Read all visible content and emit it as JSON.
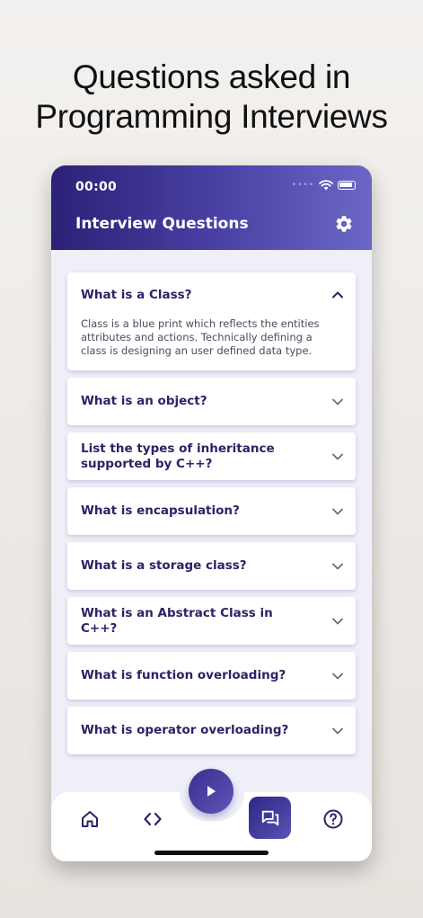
{
  "promo": {
    "line1": "Questions asked in",
    "line2": "Programming Interviews"
  },
  "status_bar": {
    "time": "00:00",
    "icons": [
      "signal-dots-icon",
      "wifi-icon",
      "battery-icon"
    ]
  },
  "app_bar": {
    "title": "Interview Questions",
    "settings_icon": "gear-icon"
  },
  "questions": [
    {
      "question": "What is a Class?",
      "expanded": true,
      "answer": "Class is a blue print which reflects the entities attributes and actions. Technically defining a class is designing an user defined data type."
    },
    {
      "question": "What is an object?",
      "expanded": false
    },
    {
      "question": "List the types of inheritance supported by C++?",
      "expanded": false
    },
    {
      "question": "What is encapsulation?",
      "expanded": false
    },
    {
      "question": "What is a storage class?",
      "expanded": false
    },
    {
      "question": "What is an Abstract Class in C++?",
      "expanded": false
    },
    {
      "question": "What is function overloading?",
      "expanded": false
    },
    {
      "question": "What is operator overloading?",
      "expanded": false
    }
  ],
  "bottom_nav": {
    "items": [
      "home-icon",
      "code-icon",
      "forum-icon",
      "help-icon"
    ],
    "active": "forum-icon",
    "fab": "play-icon"
  },
  "colors": {
    "primary_dark": "#2b2177",
    "primary_light": "#6c67c6",
    "question_text": "#2a2366",
    "background": "#efeff8"
  }
}
